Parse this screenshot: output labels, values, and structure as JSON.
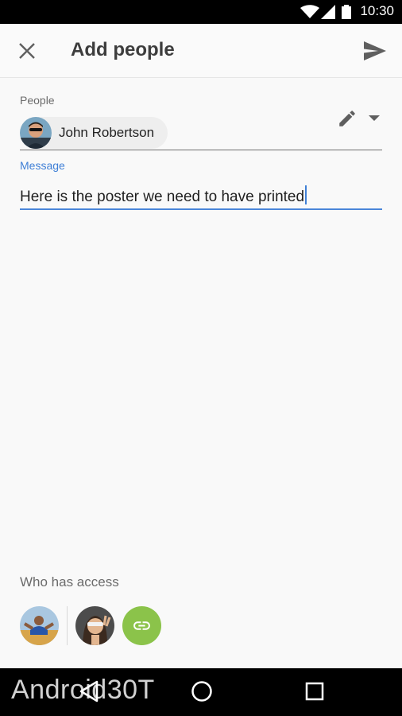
{
  "status_bar": {
    "time": "10:30",
    "icons": [
      "wifi-icon",
      "signal-icon",
      "battery-icon"
    ]
  },
  "app_bar": {
    "title": "Add people",
    "close_icon": "close-icon",
    "send_icon": "send-icon"
  },
  "people": {
    "label": "People",
    "chips": [
      {
        "name": "John Robertson"
      }
    ],
    "permission_icon": "edit-icon",
    "dropdown_icon": "dropdown-icon"
  },
  "message": {
    "label": "Message",
    "value": "Here is the poster we need to have printed"
  },
  "access": {
    "label": "Who has access",
    "link_icon": "link-icon"
  },
  "nav": {
    "icons": [
      "back-icon",
      "home-icon",
      "recents-icon"
    ]
  },
  "watermark": "Android30T",
  "colors": {
    "accent": "#3f7fd6",
    "link_button": "#8bc34a",
    "title": "#3d3d3d"
  }
}
